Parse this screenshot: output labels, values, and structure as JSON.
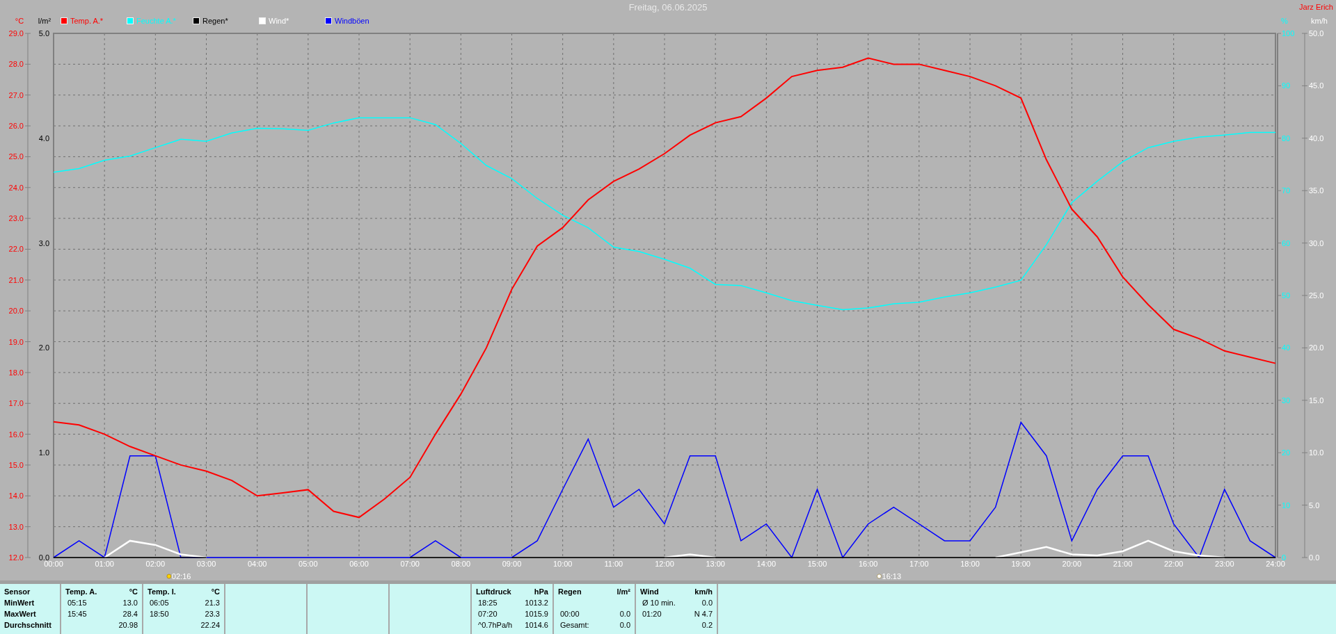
{
  "owner": "Jarz Erich",
  "chart": {
    "chart_data": {
      "type": "line",
      "title": "Freitag, 06.06.2025",
      "ylabel": "°C",
      "ylim": [
        12,
        29
      ],
      "x": [
        0,
        0.5,
        1,
        1.5,
        2,
        2.5,
        3,
        3.5,
        4,
        4.5,
        5,
        5.5,
        6,
        6.5,
        7,
        7.5,
        8,
        8.5,
        9,
        9.5,
        10,
        10.5,
        11,
        11.5,
        12,
        12.5,
        13,
        13.5,
        14,
        14.5,
        15,
        15.5,
        16,
        16.5,
        17,
        17.5,
        18,
        18.5,
        19,
        19.5,
        20,
        20.5,
        21,
        21.5,
        22,
        22.5,
        23,
        23.5,
        24
      ],
      "xticks": [
        {
          "value": 0,
          "label": "00:00"
        },
        {
          "value": 1,
          "label": "01:00"
        },
        {
          "value": 2,
          "label": "02:00"
        },
        {
          "value": 3,
          "label": "03:00"
        },
        {
          "value": 4,
          "label": "04:00"
        },
        {
          "value": 5,
          "label": "05:00"
        },
        {
          "value": 6,
          "label": "06:00"
        },
        {
          "value": 7,
          "label": "07:00"
        },
        {
          "value": 8,
          "label": "08:00"
        },
        {
          "value": 9,
          "label": "09:00"
        },
        {
          "value": 10,
          "label": "10:00"
        },
        {
          "value": 11,
          "label": "11:00"
        },
        {
          "value": 12,
          "label": "12:00"
        },
        {
          "value": 13,
          "label": "13:00"
        },
        {
          "value": 14,
          "label": "14:00"
        },
        {
          "value": 15,
          "label": "15:00"
        },
        {
          "value": 16,
          "label": "16:00"
        },
        {
          "value": 17,
          "label": "17:00"
        },
        {
          "value": 18,
          "label": "18:00"
        },
        {
          "value": 19,
          "label": "19:00"
        },
        {
          "value": 20,
          "label": "20:00"
        },
        {
          "value": 21,
          "label": "21:00"
        },
        {
          "value": 22,
          "label": "22:00"
        },
        {
          "value": 23,
          "label": "23:00"
        },
        {
          "value": 24,
          "label": "24:00"
        }
      ],
      "yticks": [
        {
          "value": 12,
          "label": "12.0"
        },
        {
          "value": 13,
          "label": "13.0"
        },
        {
          "value": 14,
          "label": "14.0"
        },
        {
          "value": 15,
          "label": "15.0"
        },
        {
          "value": 16,
          "label": "16.0"
        },
        {
          "value": 17,
          "label": "17.0"
        },
        {
          "value": 18,
          "label": "18.0"
        },
        {
          "value": 19,
          "label": "19.0"
        },
        {
          "value": 20,
          "label": "20.0"
        },
        {
          "value": 21,
          "label": "21.0"
        },
        {
          "value": 22,
          "label": "22.0"
        },
        {
          "value": 23,
          "label": "23.0"
        },
        {
          "value": 24,
          "label": "24.0"
        },
        {
          "value": 25,
          "label": "25.0"
        },
        {
          "value": 26,
          "label": "26.0"
        },
        {
          "value": 27,
          "label": "27.0"
        },
        {
          "value": 28,
          "label": "28.0"
        },
        {
          "value": 29,
          "label": "29.0"
        }
      ],
      "xlim": [
        0,
        24
      ],
      "y2label": "%",
      "y2lim": [
        0,
        100
      ],
      "y2ticks": [
        {
          "value": 0,
          "label": "0"
        },
        {
          "value": 10,
          "label": "10"
        },
        {
          "value": 20,
          "label": "20"
        },
        {
          "value": 30,
          "label": "30"
        },
        {
          "value": 40,
          "label": "40"
        },
        {
          "value": 50,
          "label": "50"
        },
        {
          "value": 60,
          "label": "60"
        },
        {
          "value": 70,
          "label": "70"
        },
        {
          "value": 80,
          "label": "80"
        },
        {
          "value": 90,
          "label": "90"
        },
        {
          "value": 100,
          "label": "100"
        }
      ],
      "y3label": "km/h",
      "y3lim": [
        0,
        50
      ],
      "y3ticks": [
        {
          "value": 0,
          "label": "0.0"
        },
        {
          "value": 5,
          "label": "5.0"
        },
        {
          "value": 10,
          "label": "10.0"
        },
        {
          "value": 15,
          "label": "15.0"
        },
        {
          "value": 20,
          "label": "20.0"
        },
        {
          "value": 25,
          "label": "25.0"
        },
        {
          "value": 30,
          "label": "30.0"
        },
        {
          "value": 35,
          "label": "35.0"
        },
        {
          "value": 40,
          "label": "40.0"
        },
        {
          "value": 45,
          "label": "45.0"
        },
        {
          "value": 50,
          "label": "50.0"
        }
      ],
      "series": [
        {
          "name": "Temp. A.*",
          "color": "#ff0000",
          "values": [
            16.4,
            16.3,
            16.0,
            15.6,
            15.3,
            15.0,
            14.8,
            14.5,
            14.0,
            14.1,
            14.2,
            13.5,
            13.3,
            13.9,
            14.6,
            16.0,
            17.3,
            18.8,
            20.7,
            22.1,
            22.7,
            23.6,
            24.2,
            24.6,
            25.1,
            25.7,
            26.1,
            26.3,
            26.9,
            27.6,
            27.8,
            27.9,
            28.2,
            28.0,
            28.0,
            27.8,
            27.6,
            27.3,
            26.9,
            24.9,
            23.3,
            22.4,
            21.1,
            20.2,
            19.4,
            19.1,
            18.7,
            18.5,
            18.3
          ]
        },
        {
          "name": "Feuchte A.*",
          "color": "#00ffff",
          "axis": "y2",
          "values": [
            73.5,
            74.2,
            75.8,
            76.6,
            78.2,
            79.8,
            79.4,
            81.0,
            81.9,
            81.8,
            81.5,
            82.9,
            83.9,
            83.9,
            83.9,
            82.6,
            79.0,
            74.8,
            72.3,
            68.5,
            65.3,
            62.9,
            59.2,
            58.4,
            56.9,
            55.2,
            52.1,
            51.9,
            50.5,
            49.0,
            48.1,
            47.3,
            47.6,
            48.4,
            48.7,
            49.7,
            50.5,
            51.6,
            52.9,
            59.7,
            67.7,
            71.8,
            75.5,
            78.2,
            79.4,
            80.2,
            80.6,
            81.1,
            81.1
          ]
        },
        {
          "name": "Regen*",
          "color": "#000000",
          "axis": "y3",
          "values": [
            0,
            0,
            0,
            0,
            0,
            0,
            0,
            null,
            null,
            null,
            null,
            null,
            null,
            null,
            0,
            0,
            0,
            null,
            0,
            0,
            0,
            0,
            0,
            0,
            0,
            0,
            0,
            0,
            0,
            0,
            0,
            0,
            0,
            0,
            0,
            0,
            0,
            0,
            0,
            0,
            0,
            0,
            0,
            0,
            0,
            0,
            0,
            0,
            0
          ]
        },
        {
          "name": "Wind*",
          "color": "#ffffff",
          "axis": "y3",
          "values": [
            null,
            null,
            0,
            1.6,
            1.2,
            0.3,
            0,
            null,
            null,
            null,
            null,
            null,
            null,
            null,
            null,
            null,
            null,
            null,
            null,
            null,
            null,
            null,
            null,
            null,
            0,
            0.3,
            0,
            null,
            null,
            null,
            null,
            null,
            null,
            null,
            null,
            null,
            null,
            0,
            0.5,
            1.0,
            0.3,
            0.2,
            0.6,
            1.6,
            0.6,
            0.2,
            0,
            null,
            null
          ]
        },
        {
          "name": "Windböen",
          "color": "#0000ff",
          "axis": "y3",
          "values": [
            0,
            1.6,
            0,
            9.7,
            9.7,
            0,
            0,
            0,
            0,
            0,
            0,
            0,
            0,
            0,
            0,
            1.6,
            0,
            0,
            0,
            1.6,
            6.5,
            11.3,
            4.8,
            6.5,
            3.2,
            9.7,
            9.7,
            1.6,
            3.2,
            0,
            6.5,
            0,
            3.2,
            4.8,
            3.2,
            1.6,
            1.6,
            4.8,
            12.9,
            9.7,
            1.6,
            6.5,
            9.7,
            9.7,
            3.2,
            0,
            6.5,
            1.6,
            0
          ]
        }
      ],
      "grid": true
    },
    "markers": [
      {
        "kind": "sunrise",
        "time": "02:16"
      },
      {
        "kind": "sunset",
        "time": "16:13"
      }
    ],
    "rain_axis": {
      "label": "l/m²",
      "ticks": [
        "5.0",
        "4.0",
        "3.0",
        "2.0",
        "1.0",
        "0.0"
      ]
    }
  },
  "table": {
    "columns": [
      {
        "kind": "labels",
        "title": "Sensor",
        "rows": [
          "MinWert",
          "MaxWert",
          "Durchschnitt"
        ]
      },
      {
        "kind": "data",
        "title": "Temp. A.",
        "unit": "°C",
        "rows": [
          {
            "label": "05:15",
            "value": "13.0"
          },
          {
            "label": "15:45",
            "value": "28.4"
          },
          {
            "value": "20.98"
          }
        ]
      },
      {
        "kind": "data",
        "title": "Temp. I.",
        "unit": "°C",
        "rows": [
          {
            "label": "06:05",
            "value": "21.3"
          },
          {
            "label": "18:50",
            "value": "23.3"
          },
          {
            "value": "22.24"
          }
        ]
      },
      {
        "kind": "blank"
      },
      {
        "kind": "blank"
      },
      {
        "kind": "blank"
      },
      {
        "kind": "data",
        "title": "Luftdruck",
        "unit": "hPa",
        "rows": [
          {
            "label": "18:25",
            "value": "1013.2"
          },
          {
            "label": "07:20",
            "value": "1015.9"
          },
          {
            "label": "^0.7hPa/h",
            "value": "1014.6"
          }
        ]
      },
      {
        "kind": "data",
        "title": "Regen",
        "unit": "l/m²",
        "rows": [
          {},
          {
            "label": "00:00",
            "value": "0.0"
          },
          {
            "label": "Gesamt:",
            "value": "0.0"
          }
        ]
      },
      {
        "kind": "data",
        "title": "Wind",
        "unit": "km/h",
        "rows": [
          {
            "label": "Ø 10 min.",
            "value": "0.0"
          },
          {
            "label": "01:20",
            "value": "N 4.7"
          },
          {
            "value": "0.2"
          }
        ]
      }
    ]
  }
}
